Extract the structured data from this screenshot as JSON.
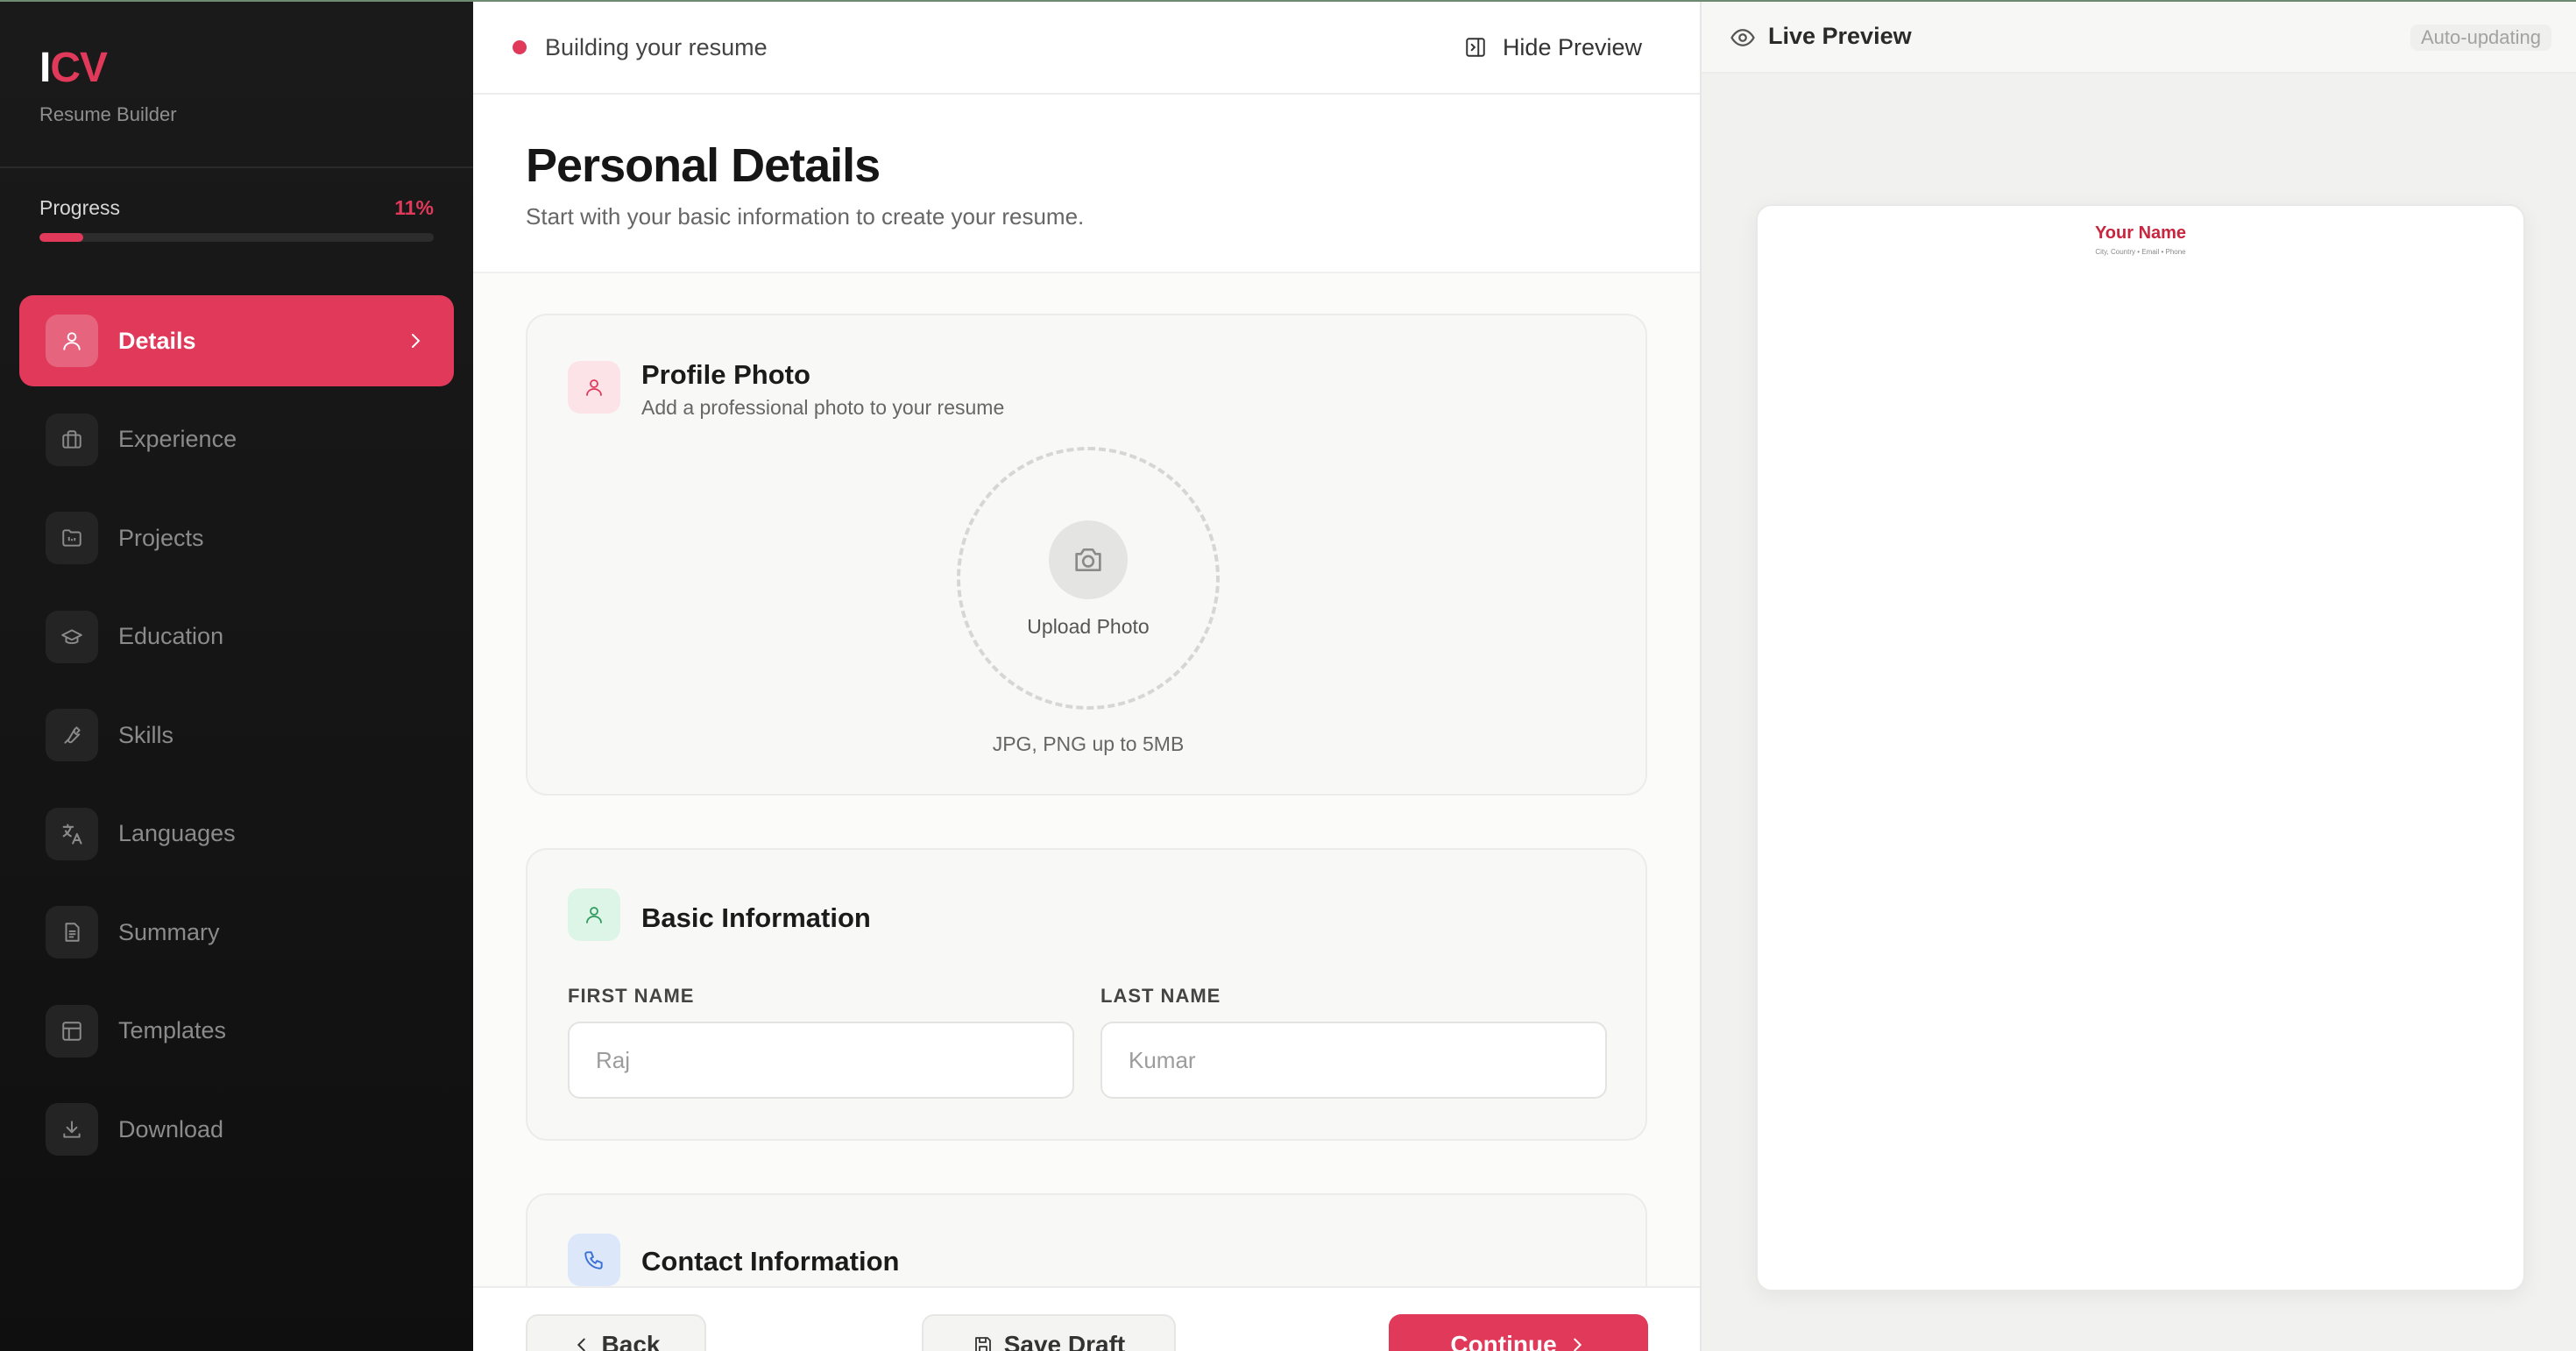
{
  "brand": {
    "logo_part1": "I",
    "logo_part2": "CV",
    "subtitle": "Resume Builder"
  },
  "progress": {
    "label": "Progress",
    "value_text": "11%",
    "fraction": 0.11
  },
  "sidebar": {
    "items": [
      {
        "label": "Details",
        "icon": "user-icon",
        "active": true
      },
      {
        "label": "Experience",
        "icon": "briefcase-icon"
      },
      {
        "label": "Projects",
        "icon": "folder-icon"
      },
      {
        "label": "Education",
        "icon": "graduation-cap-icon"
      },
      {
        "label": "Skills",
        "icon": "wrench-icon"
      },
      {
        "label": "Languages",
        "icon": "translate-icon"
      },
      {
        "label": "Summary",
        "icon": "document-icon"
      },
      {
        "label": "Templates",
        "icon": "layout-icon"
      },
      {
        "label": "Download",
        "icon": "download-icon"
      }
    ]
  },
  "topbar": {
    "status_text": "Building your resume",
    "hide_preview_label": "Hide Preview"
  },
  "header": {
    "title": "Personal Details",
    "subtitle": "Start with your basic information to create your resume."
  },
  "profile_photo": {
    "title": "Profile Photo",
    "subtitle": "Add a professional photo to your resume",
    "upload_label": "Upload Photo",
    "hint": "JPG, PNG up to 5MB"
  },
  "basic_info": {
    "title": "Basic Information",
    "first_name_label": "FIRST NAME",
    "first_name_placeholder": "Raj",
    "last_name_label": "LAST NAME",
    "last_name_placeholder": "Kumar"
  },
  "contact_info": {
    "title": "Contact Information"
  },
  "footer": {
    "back_label": "Back",
    "save_label": "Save Draft",
    "continue_label": "Continue"
  },
  "preview": {
    "title": "Live Preview",
    "auto_label": "Auto-updating",
    "name": "Your Name",
    "contact": "City, Country • Email • Phone"
  },
  "colors": {
    "accent": "#e0395a",
    "sidebar_bg": "#161616"
  }
}
